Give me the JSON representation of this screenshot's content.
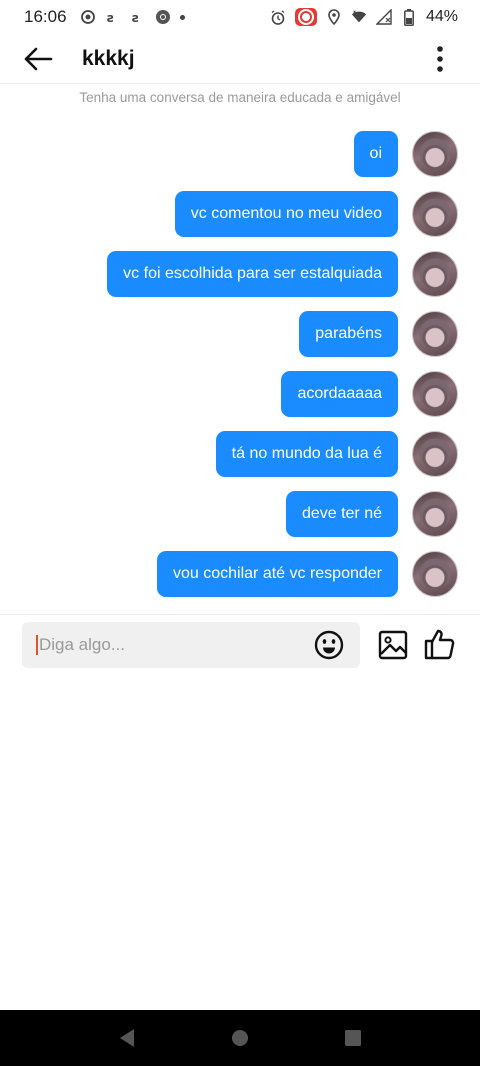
{
  "status_bar": {
    "time": "16:06",
    "battery": "44%",
    "left_icons": [
      "gps-target-icon",
      "teams-icon",
      "teams-icon",
      "chrome-icon",
      "dot-icon"
    ],
    "right_icons": [
      "alarm-icon",
      "screen-record-icon",
      "location-icon",
      "wifi-icon",
      "signal-icon",
      "battery-icon"
    ]
  },
  "header": {
    "title": "kkkkj"
  },
  "notice": "Tenha uma conversa de maneira educada e amigável",
  "messages": [
    {
      "text": "oi"
    },
    {
      "text": "vc comentou no meu video"
    },
    {
      "text": "vc foi escolhida para ser estalquiada"
    },
    {
      "text": "parabéns"
    },
    {
      "text": "acordaaaaa"
    },
    {
      "text": "tá no mundo da lua é"
    },
    {
      "text": "deve ter né"
    },
    {
      "text": "vou cochilar até vc responder"
    }
  ],
  "composer": {
    "placeholder": "Diga algo..."
  },
  "colors": {
    "bubble": "#1a8cff",
    "bubble_text": "#ffffff",
    "caret": "#e6532b"
  }
}
